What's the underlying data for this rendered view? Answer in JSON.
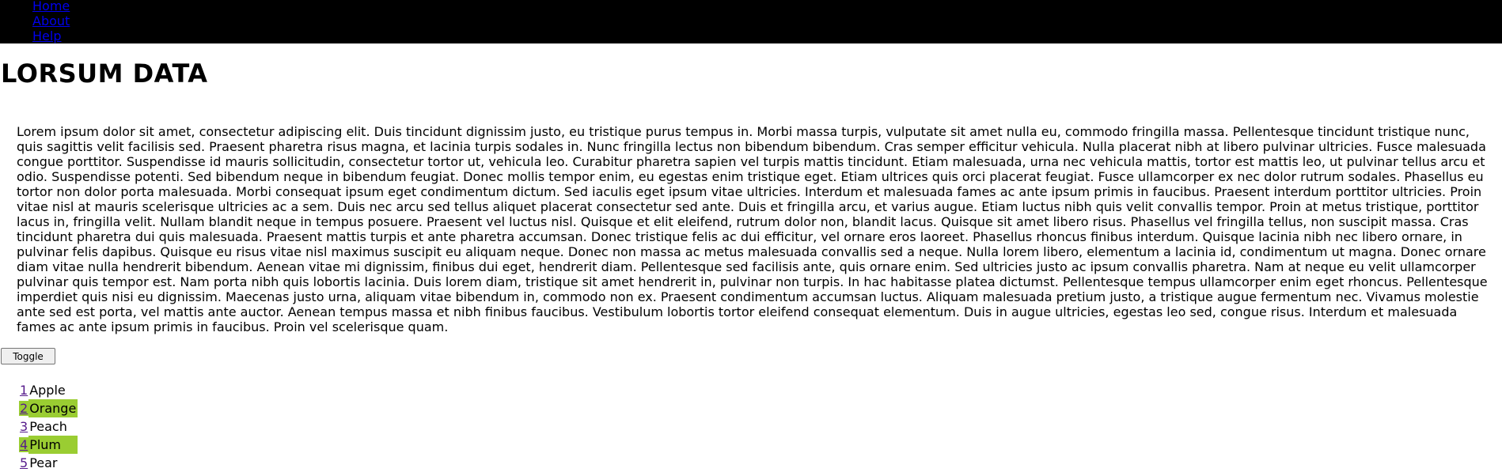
{
  "nav": {
    "items": [
      {
        "label": "Home"
      },
      {
        "label": "About"
      },
      {
        "label": "Help"
      }
    ]
  },
  "page": {
    "title": "LORSUM DATA",
    "body": "Lorem ipsum dolor sit amet, consectetur adipiscing elit. Duis tincidunt dignissim justo, eu tristique purus tempus in. Morbi massa turpis, vulputate sit amet nulla eu, commodo fringilla massa. Pellentesque tincidunt tristique nunc, quis sagittis velit facilisis sed. Praesent pharetra risus magna, et lacinia turpis sodales in. Nunc fringilla lectus non bibendum bibendum. Cras semper efficitur vehicula. Nulla placerat nibh at libero pulvinar ultricies. Fusce malesuada congue porttitor. Suspendisse id mauris sollicitudin, consectetur tortor ut, vehicula leo. Curabitur pharetra sapien vel turpis mattis tincidunt. Etiam malesuada, urna nec vehicula mattis, tortor est mattis leo, ut pulvinar tellus arcu et odio. Suspendisse potenti. Sed bibendum neque in bibendum feugiat. Donec mollis tempor enim, eu egestas enim tristique eget. Etiam ultrices quis orci placerat feugiat. Fusce ullamcorper ex nec dolor rutrum sodales. Phasellus eu tortor non dolor porta malesuada. Morbi consequat ipsum eget condimentum dictum. Sed iaculis eget ipsum vitae ultricies. Interdum et malesuada fames ac ante ipsum primis in faucibus. Praesent interdum porttitor ultricies. Proin vitae nisl at mauris scelerisque ultricies ac a sem. Duis nec arcu sed tellus aliquet placerat consectetur sed ante. Duis et fringilla arcu, et varius augue. Etiam luctus nibh quis velit convallis tempor. Proin at metus tristique, porttitor lacus in, fringilla velit. Nullam blandit neque in tempus posuere. Praesent vel luctus nisl. Quisque et elit eleifend, rutrum dolor non, blandit lacus. Quisque sit amet libero risus. Phasellus vel fringilla tellus, non suscipit massa. Cras tincidunt pharetra dui quis malesuada. Praesent mattis turpis et ante pharetra accumsan. Donec tristique felis ac dui efficitur, vel ornare eros laoreet. Phasellus rhoncus finibus interdum. Quisque lacinia nibh nec libero ornare, in pulvinar felis dapibus. Quisque eu risus vitae nisl maximus suscipit eu aliquam neque. Donec non massa ac metus malesuada convallis sed a neque. Nulla lorem libero, elementum a lacinia id, condimentum ut magna. Donec ornare diam vitae nulla hendrerit bibendum. Aenean vitae mi dignissim, finibus dui eget, hendrerit diam. Pellentesque sed facilisis ante, quis ornare enim. Sed ultricies justo ac ipsum convallis pharetra. Nam at neque eu velit ullamcorper pulvinar quis tempor est. Nam porta nibh quis lobortis lacinia. Duis lorem diam, tristique sit amet hendrerit in, pulvinar non turpis. In hac habitasse platea dictumst. Pellentesque tempus ullamcorper enim eget rhoncus. Pellentesque imperdiet quis nisi eu dignissim. Maecenas justo urna, aliquam vitae bibendum in, commodo non ex. Praesent condimentum accumsan luctus. Aliquam malesuada pretium justo, a tristique augue fermentum nec. Vivamus molestie ante sed est porta, vel mattis ante auctor. Aenean tempus massa et nibh finibus faucibus. Vestibulum lobortis tortor eleifend consequat elementum. Duis in augue ultricies, egestas leo sed, congue risus. Interdum et malesuada fames ac ante ipsum primis in faucibus. Proin vel scelerisque quam.",
    "toggle_label": "Toggle"
  },
  "colors": {
    "nav_background": "#000000",
    "link": "#0000ee",
    "visited_link": "#551a8b",
    "highlight": "#9acd32"
  },
  "fruits": [
    {
      "num": "1",
      "name": "Apple",
      "highlighted": false
    },
    {
      "num": "2",
      "name": "Orange",
      "highlighted": true
    },
    {
      "num": "3",
      "name": "Peach",
      "highlighted": false
    },
    {
      "num": "4",
      "name": "Plum",
      "highlighted": true
    },
    {
      "num": "5",
      "name": "Pear",
      "highlighted": false
    }
  ]
}
